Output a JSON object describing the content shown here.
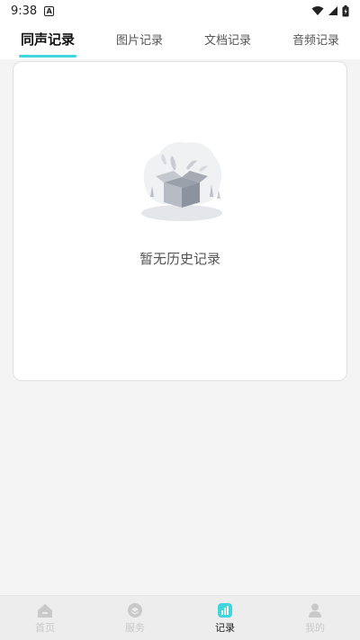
{
  "status_bar": {
    "time": "9:38",
    "badge": "A"
  },
  "tabs": [
    {
      "label": "同声记录",
      "active": true
    },
    {
      "label": "图片记录",
      "active": false
    },
    {
      "label": "文档记录",
      "active": false
    },
    {
      "label": "音频记录",
      "active": false
    }
  ],
  "empty_state": {
    "message": "暂无历史记录",
    "icon": "empty-box-icon"
  },
  "bottom_nav": [
    {
      "label": "首页",
      "icon": "home-icon",
      "active": false
    },
    {
      "label": "服务",
      "icon": "service-icon",
      "active": false
    },
    {
      "label": "记录",
      "icon": "record-icon",
      "active": true
    },
    {
      "label": "我的",
      "icon": "profile-icon",
      "active": false
    }
  ],
  "colors": {
    "accent": "#3fd6de",
    "background": "#f4f4f4",
    "card": "#ffffff"
  }
}
